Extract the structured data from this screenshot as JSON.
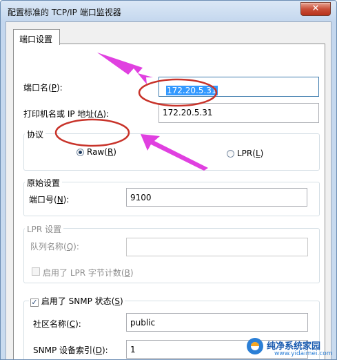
{
  "window": {
    "title": "配置标准的 TCP/IP 端口监视器",
    "close_glyph": "✕"
  },
  "tabs": [
    {
      "label": "端口设置"
    }
  ],
  "port_name": {
    "label": "端口名(",
    "key": "P",
    "suffix": "):",
    "value": "172.20.5.31"
  },
  "printer_address": {
    "label": "打印机名或 IP 地址(",
    "key": "A",
    "suffix": "):",
    "value": "172.20.5.31"
  },
  "protocol": {
    "title": "协议",
    "raw": {
      "label": "Raw(",
      "key": "R",
      "suffix": ")",
      "checked": true
    },
    "lpr": {
      "label": "LPR(",
      "key": "L",
      "suffix": ")",
      "checked": false
    }
  },
  "raw_settings": {
    "title": "原始设置",
    "port_number": {
      "label": "端口号(",
      "key": "N",
      "suffix": "):",
      "value": "9100"
    }
  },
  "lpr_settings": {
    "title": "LPR 设置",
    "queue_name": {
      "label": "队列名称(",
      "key": "Q",
      "suffix": "):",
      "value": ""
    },
    "byte_counting": {
      "label": "启用了 LPR 字节计数(",
      "key": "B",
      "suffix": ")",
      "checked": false
    }
  },
  "snmp": {
    "enabled": {
      "label": "启用了 SNMP 状态(",
      "key": "S",
      "suffix": ")",
      "checked": true
    },
    "community": {
      "label": "社区名称(",
      "key": "C",
      "suffix": "):",
      "value": "public"
    },
    "device_index": {
      "label": "SNMP 设备索引(",
      "key": "D",
      "suffix": "):",
      "value": "1"
    }
  },
  "watermark": {
    "brand": "纯净系统家园",
    "url": "www.yidaimei.com"
  },
  "colors": {
    "annotation": "#e040e0",
    "circle": "#c8332a",
    "selection": "#3399ff"
  }
}
